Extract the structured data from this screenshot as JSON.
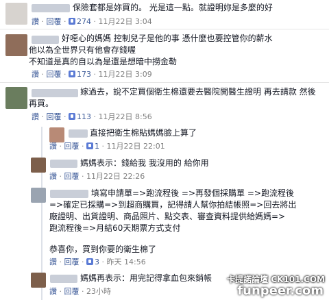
{
  "comments": [
    {
      "lines": [
        "保險套都是妳買的。 光是這一點。就證明妳是多麼的好"
      ],
      "actions": {
        "like": "讚",
        "reply": "回覆",
        "count": "274",
        "time": "11月22日 3:04"
      }
    },
    {
      "lines": [
        "好噁心的媽媽 控制兒子是他的事 憑什麼也要控管你的薪水",
        "他以為全世界只有他會存錢喔",
        "不知道是真的自以為是還是想暗中撈金勒"
      ],
      "actions": {
        "like": "讚",
        "reply": "回覆",
        "count": "173",
        "time": "11月22日 3:09"
      }
    },
    {
      "lines": [
        "嫁過去，說不定買個衛生棉還要去醫院開醫生證明 再去請款 然後",
        "再買。"
      ],
      "actions": {
        "like": "讚",
        "reply": "回覆",
        "count": "113",
        "time": "11月22日 8:56"
      }
    }
  ],
  "replies": [
    {
      "lines": [
        "直接把衛生棉貼媽媽臉上算了"
      ],
      "actions": {
        "like": "讚",
        "reply": "回覆",
        "count": "1",
        "time": "11月22日 22:01"
      }
    },
    {
      "lines": [
        "媽媽表示：錢給我 我沒用的 給你用"
      ],
      "actions": {
        "like": "讚",
        "reply": "回覆",
        "time": "11月22日 22:26"
      }
    },
    {
      "lines": [
        "填寫申請單=>跑流程後 =>再發個採購單 =>跑流程後",
        "=>確定已採購=>到超商購買，記得請人幫你拍結帳照=>回去將出",
        "廠證明、出貨證明、商品照片、點交表、審查資料提供給媽媽=>",
        "跑流程後=>月結60天期票方式支付",
        "",
        "恭喜你，買到你要的衛生棉了"
      ],
      "actions": {
        "like": "讚",
        "reply": "回覆",
        "count": "3",
        "time": "昨天 14:56"
      }
    },
    {
      "lines": [
        "媽媽再表示：用完記得拿血包來銷帳"
      ],
      "actions": {
        "like": "讚",
        "reply": "回覆",
        "time": "23小時"
      }
    }
  ],
  "watermark": "卡提諾論壇 CK101.COM",
  "watermark2": "funpeer.com"
}
